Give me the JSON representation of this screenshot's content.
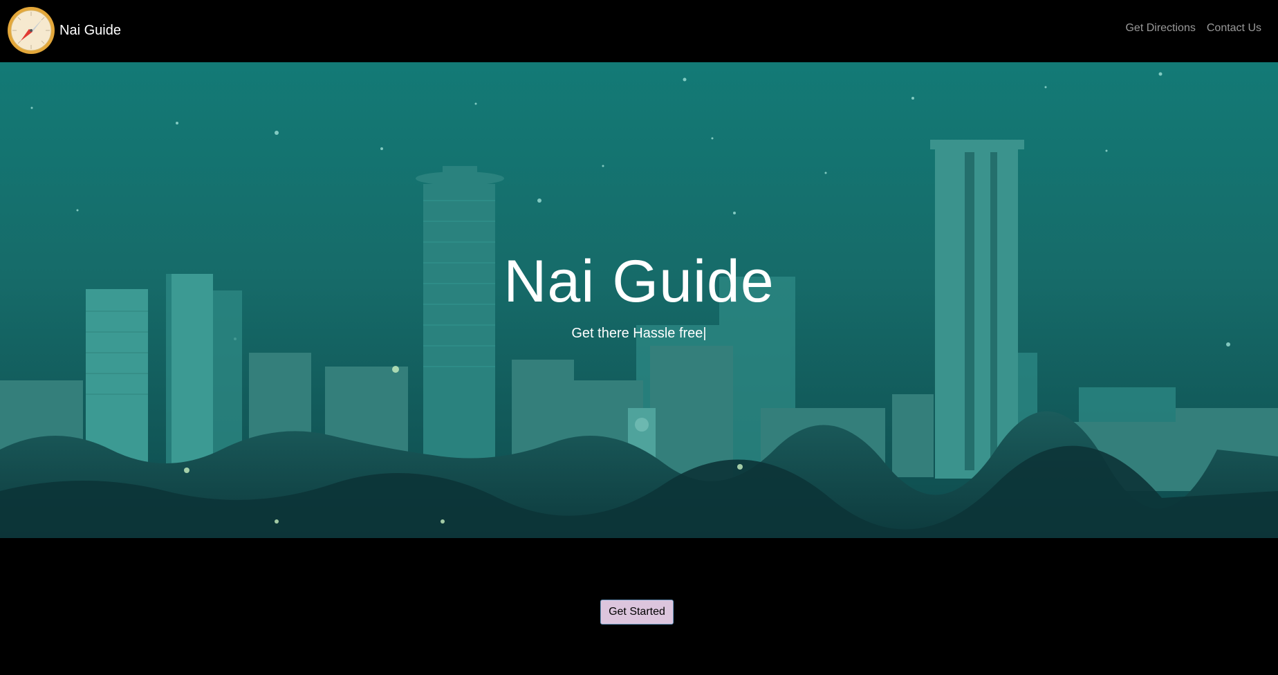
{
  "navbar": {
    "brand_name": "Nai Guide",
    "logo_icon": "compass-icon",
    "links": [
      {
        "label": "Get Directions"
      },
      {
        "label": "Contact Us"
      }
    ]
  },
  "hero": {
    "title": "Nai Guide",
    "subtitle": "Get there Hassle free|",
    "background": "Nairobi city skyline at night with teal tint"
  },
  "cta": {
    "label": "Get Started"
  },
  "colors": {
    "background": "#000000",
    "hero_tint": "#1b7a76",
    "nav_link": "#9a9a9a",
    "button_bg": "#dcc5dd",
    "button_border": "#6d9bc4",
    "logo_ring": "#e3a73a"
  }
}
